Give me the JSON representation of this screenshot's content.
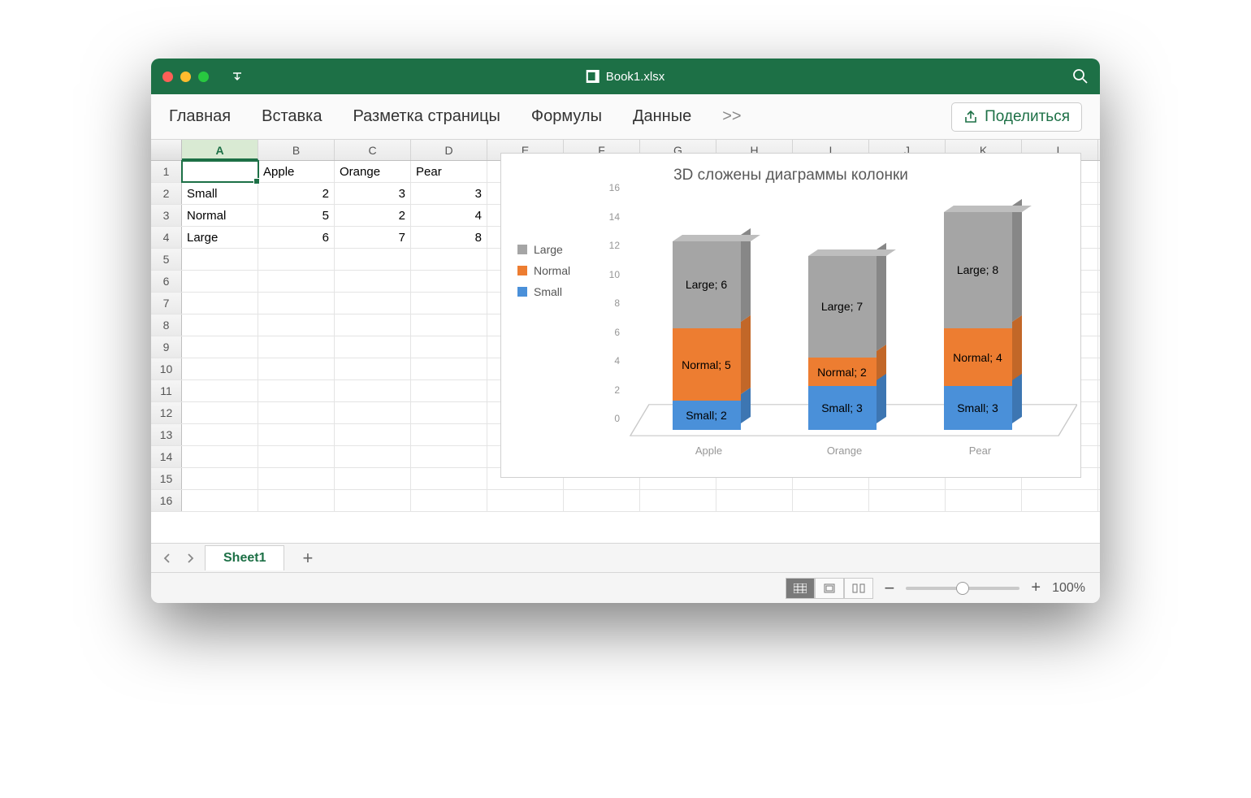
{
  "window": {
    "title": "Book1.xlsx"
  },
  "ribbon": {
    "tabs": [
      "Главная",
      "Вставка",
      "Разметка страницы",
      "Формулы",
      "Данные"
    ],
    "overflow": ">>",
    "share": "Поделиться"
  },
  "columns": [
    "A",
    "B",
    "C",
    "D",
    "E",
    "F",
    "G",
    "H",
    "I",
    "J",
    "K",
    "L"
  ],
  "row_count": 16,
  "active_cell": "A1",
  "table": {
    "headers": [
      "",
      "Apple",
      "Orange",
      "Pear"
    ],
    "rows": [
      {
        "label": "Small",
        "values": [
          2,
          3,
          3
        ]
      },
      {
        "label": "Normal",
        "values": [
          5,
          2,
          4
        ]
      },
      {
        "label": "Large",
        "values": [
          6,
          7,
          8
        ]
      }
    ]
  },
  "chart_data": {
    "type": "bar",
    "stacked": true,
    "three_d": true,
    "title": "3D сложены диаграммы колонки",
    "categories": [
      "Apple",
      "Orange",
      "Pear"
    ],
    "series": [
      {
        "name": "Small",
        "color": "#4a90d9",
        "values": [
          2,
          3,
          3
        ]
      },
      {
        "name": "Normal",
        "color": "#ed7d31",
        "values": [
          5,
          2,
          4
        ]
      },
      {
        "name": "Large",
        "color": "#a5a5a5",
        "values": [
          6,
          7,
          8
        ]
      }
    ],
    "legend_order": [
      "Large",
      "Normal",
      "Small"
    ],
    "ylim": [
      0,
      16
    ],
    "yticks": [
      0,
      2,
      4,
      6,
      8,
      10,
      12,
      14,
      16
    ],
    "data_labels": [
      [
        "Small; 2",
        "Normal; 5",
        "Large; 6"
      ],
      [
        "Small; 3",
        "Normal; 2",
        "Large; 7"
      ],
      [
        "Small; 3",
        "Normal; 4",
        "Large; 8"
      ]
    ]
  },
  "sheet": {
    "active": "Sheet1"
  },
  "status": {
    "zoom": "100%"
  }
}
